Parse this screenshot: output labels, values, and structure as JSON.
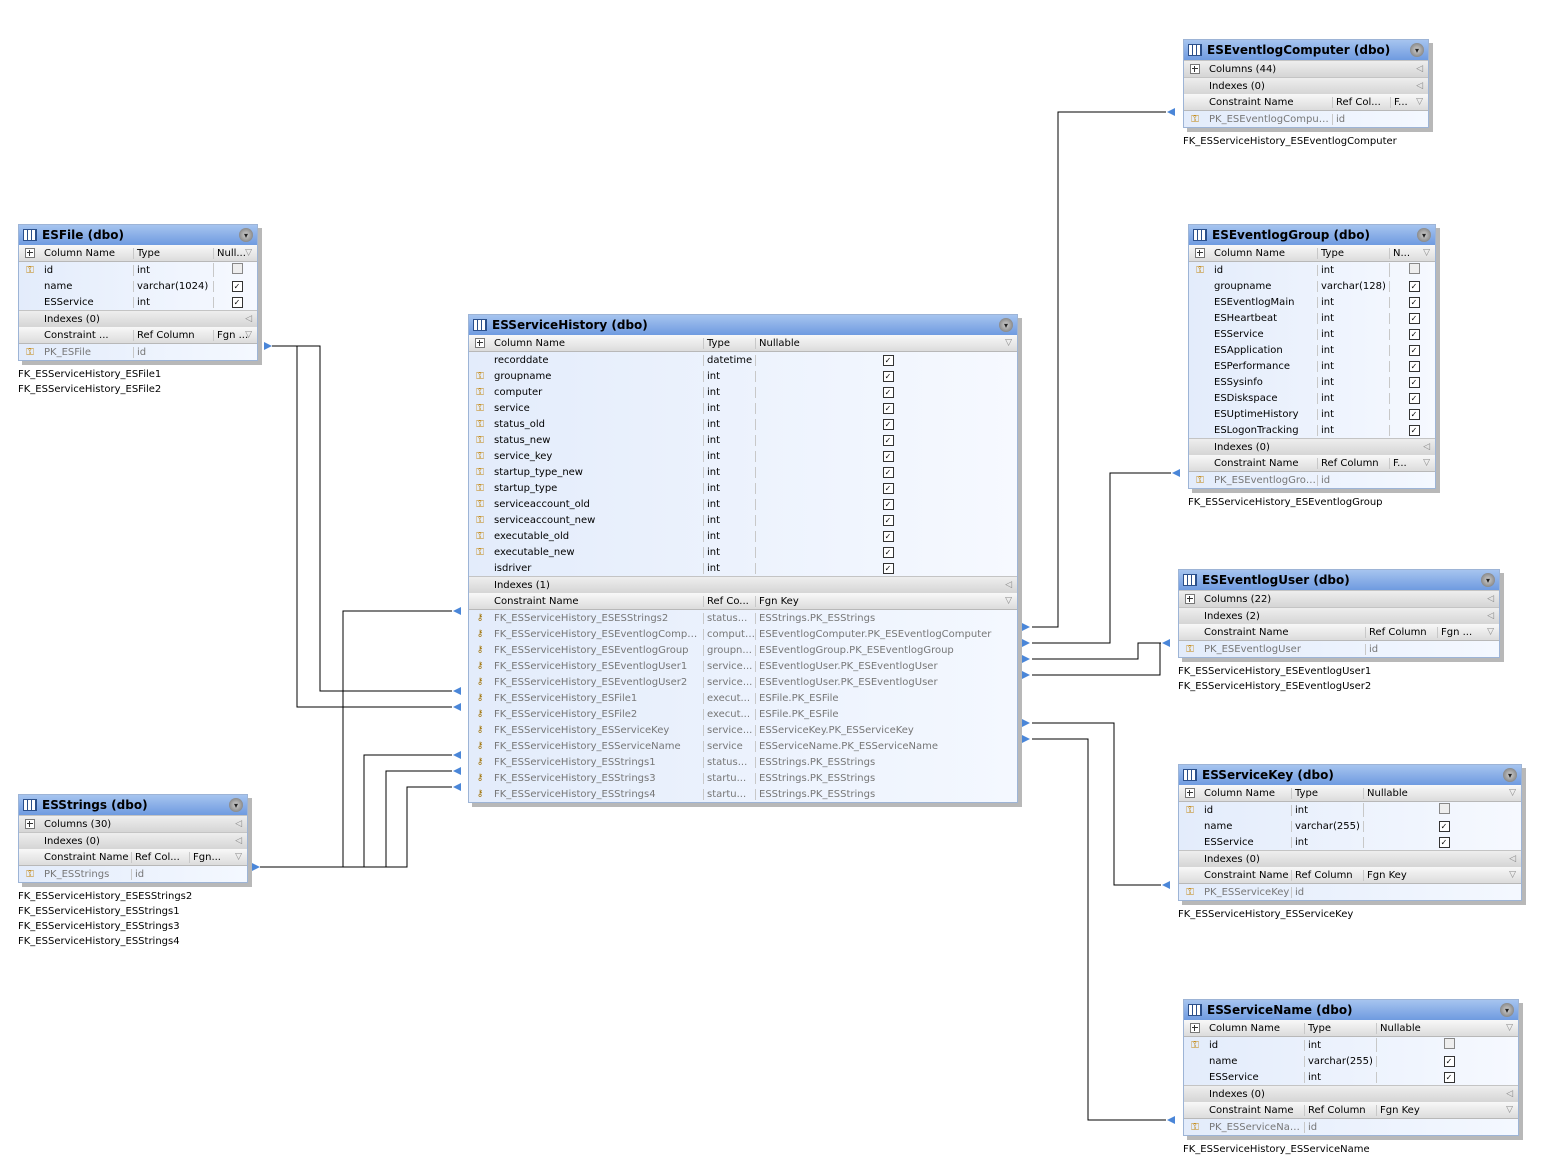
{
  "tables": [
    {
      "id": "ESFile",
      "title": "ESFile (dbo)",
      "expanded": true,
      "header": [
        "Column Name",
        "Type",
        "Null..."
      ],
      "columns": [
        {
          "name": "id",
          "type": "int",
          "nullable": false,
          "key": true
        },
        {
          "name": "name",
          "type": "varchar(1024)",
          "nullable": true,
          "key": false
        },
        {
          "name": "ESService",
          "type": "int",
          "nullable": true,
          "key": false
        }
      ],
      "indexes": "Indexes (0)",
      "constraint_header": [
        "Constraint ...",
        "Ref Column",
        "Fgn ..."
      ],
      "constraints": [
        {
          "name": "PK_ESFile",
          "ref": "id",
          "fgn": ""
        }
      ],
      "captions": [
        "FK_ESServiceHistory_ESFile1",
        "FK_ESServiceHistory_ESFile2"
      ]
    },
    {
      "id": "ESStrings",
      "title": "ESStrings (dbo)",
      "expanded": false,
      "columns_summary": "Columns (30)",
      "indexes": "Indexes (0)",
      "constraint_header": [
        "Constraint Name",
        "Ref Col...",
        "Fgn..."
      ],
      "constraints": [
        {
          "name": "PK_ESStrings",
          "ref": "id",
          "fgn": ""
        }
      ],
      "captions": [
        "FK_ESServiceHistory_ESESStrings2",
        "FK_ESServiceHistory_ESStrings1",
        "FK_ESServiceHistory_ESStrings3",
        "FK_ESServiceHistory_ESStrings4"
      ]
    },
    {
      "id": "ESServiceHistory",
      "title": "ESServiceHistory (dbo)",
      "expanded": true,
      "header": [
        "Column Name",
        "Type",
        "Nullable"
      ],
      "columns": [
        {
          "name": "recorddate",
          "type": "datetime",
          "nullable": true,
          "key": false
        },
        {
          "name": "groupname",
          "type": "int",
          "nullable": true,
          "key": true
        },
        {
          "name": "computer",
          "type": "int",
          "nullable": true,
          "key": true
        },
        {
          "name": "service",
          "type": "int",
          "nullable": true,
          "key": true
        },
        {
          "name": "status_old",
          "type": "int",
          "nullable": true,
          "key": true
        },
        {
          "name": "status_new",
          "type": "int",
          "nullable": true,
          "key": true
        },
        {
          "name": "service_key",
          "type": "int",
          "nullable": true,
          "key": true
        },
        {
          "name": "startup_type_new",
          "type": "int",
          "nullable": true,
          "key": true
        },
        {
          "name": "startup_type",
          "type": "int",
          "nullable": true,
          "key": true
        },
        {
          "name": "serviceaccount_old",
          "type": "int",
          "nullable": true,
          "key": true
        },
        {
          "name": "serviceaccount_new",
          "type": "int",
          "nullable": true,
          "key": true
        },
        {
          "name": "executable_old",
          "type": "int",
          "nullable": true,
          "key": true
        },
        {
          "name": "executable_new",
          "type": "int",
          "nullable": true,
          "key": true
        },
        {
          "name": "isdriver",
          "type": "int",
          "nullable": true,
          "key": false
        }
      ],
      "indexes": "Indexes (1)",
      "constraint_header": [
        "Constraint Name",
        "Ref Co...",
        "Fgn Key"
      ],
      "constraints": [
        {
          "name": "FK_ESServiceHistory_ESESStrings2",
          "ref": "status...",
          "fgn": "ESStrings.PK_ESStrings"
        },
        {
          "name": "FK_ESServiceHistory_ESEventlogComputer",
          "ref": "computer",
          "fgn": "ESEventlogComputer.PK_ESEventlogComputer"
        },
        {
          "name": "FK_ESServiceHistory_ESEventlogGroup",
          "ref": "groupn...",
          "fgn": "ESEventlogGroup.PK_ESEventlogGroup"
        },
        {
          "name": "FK_ESServiceHistory_ESEventlogUser1",
          "ref": "service...",
          "fgn": "ESEventlogUser.PK_ESEventlogUser"
        },
        {
          "name": "FK_ESServiceHistory_ESEventlogUser2",
          "ref": "service...",
          "fgn": "ESEventlogUser.PK_ESEventlogUser"
        },
        {
          "name": "FK_ESServiceHistory_ESFile1",
          "ref": "execut...",
          "fgn": "ESFile.PK_ESFile"
        },
        {
          "name": "FK_ESServiceHistory_ESFile2",
          "ref": "execut...",
          "fgn": "ESFile.PK_ESFile"
        },
        {
          "name": "FK_ESServiceHistory_ESServiceKey",
          "ref": "service...",
          "fgn": "ESServiceKey.PK_ESServiceKey"
        },
        {
          "name": "FK_ESServiceHistory_ESServiceName",
          "ref": "service",
          "fgn": "ESServiceName.PK_ESServiceName"
        },
        {
          "name": "FK_ESServiceHistory_ESStrings1",
          "ref": "status...",
          "fgn": "ESStrings.PK_ESStrings"
        },
        {
          "name": "FK_ESServiceHistory_ESStrings3",
          "ref": "startu...",
          "fgn": "ESStrings.PK_ESStrings"
        },
        {
          "name": "FK_ESServiceHistory_ESStrings4",
          "ref": "startu...",
          "fgn": "ESStrings.PK_ESStrings"
        }
      ],
      "captions": []
    },
    {
      "id": "ESEventlogComputer",
      "title": "ESEventlogComputer (dbo)",
      "expanded": false,
      "columns_summary": "Columns (44)",
      "indexes": "Indexes (0)",
      "constraint_header": [
        "Constraint Name",
        "Ref Col...",
        "F..."
      ],
      "constraints": [
        {
          "name": "PK_ESEventlogComputer",
          "ref": "id",
          "fgn": ""
        }
      ],
      "captions": [
        "FK_ESServiceHistory_ESEventlogComputer"
      ]
    },
    {
      "id": "ESEventlogGroup",
      "title": "ESEventlogGroup (dbo)",
      "expanded": true,
      "header": [
        "Column Name",
        "Type",
        "N..."
      ],
      "columns": [
        {
          "name": "id",
          "type": "int",
          "nullable": false,
          "key": true
        },
        {
          "name": "groupname",
          "type": "varchar(128)",
          "nullable": true,
          "key": false
        },
        {
          "name": "ESEventlogMain",
          "type": "int",
          "nullable": true,
          "key": false
        },
        {
          "name": "ESHeartbeat",
          "type": "int",
          "nullable": true,
          "key": false
        },
        {
          "name": "ESService",
          "type": "int",
          "nullable": true,
          "key": false
        },
        {
          "name": "ESApplication",
          "type": "int",
          "nullable": true,
          "key": false
        },
        {
          "name": "ESPerformance",
          "type": "int",
          "nullable": true,
          "key": false
        },
        {
          "name": "ESSysinfo",
          "type": "int",
          "nullable": true,
          "key": false
        },
        {
          "name": "ESDiskspace",
          "type": "int",
          "nullable": true,
          "key": false
        },
        {
          "name": "ESUptimeHistory",
          "type": "int",
          "nullable": true,
          "key": false
        },
        {
          "name": "ESLogonTracking",
          "type": "int",
          "nullable": true,
          "key": false
        }
      ],
      "indexes": "Indexes (0)",
      "constraint_header": [
        "Constraint Name",
        "Ref Column",
        "F..."
      ],
      "constraints": [
        {
          "name": "PK_ESEventlogGroup",
          "ref": "id",
          "fgn": ""
        }
      ],
      "captions": [
        "FK_ESServiceHistory_ESEventlogGroup"
      ]
    },
    {
      "id": "ESEventlogUser",
      "title": "ESEventlogUser (dbo)",
      "expanded": false,
      "columns_summary": "Columns (22)",
      "indexes": "Indexes (2)",
      "constraint_header": [
        "Constraint Name",
        "Ref Column",
        "Fgn ..."
      ],
      "constraints": [
        {
          "name": "PK_ESEventlogUser",
          "ref": "id",
          "fgn": ""
        }
      ],
      "captions": [
        "FK_ESServiceHistory_ESEventlogUser1",
        "FK_ESServiceHistory_ESEventlogUser2"
      ]
    },
    {
      "id": "ESServiceKey",
      "title": "ESServiceKey (dbo)",
      "expanded": true,
      "header": [
        "Column Name",
        "Type",
        "Nullable"
      ],
      "columns": [
        {
          "name": "id",
          "type": "int",
          "nullable": false,
          "key": true
        },
        {
          "name": "name",
          "type": "varchar(255)",
          "nullable": true,
          "key": false
        },
        {
          "name": "ESService",
          "type": "int",
          "nullable": true,
          "key": false
        }
      ],
      "indexes": "Indexes (0)",
      "constraint_header": [
        "Constraint Name",
        "Ref Column",
        "Fgn Key"
      ],
      "constraints": [
        {
          "name": "PK_ESServiceKey",
          "ref": "id",
          "fgn": ""
        }
      ],
      "captions": [
        "FK_ESServiceHistory_ESServiceKey"
      ]
    },
    {
      "id": "ESServiceName",
      "title": "ESServiceName (dbo)",
      "expanded": true,
      "header": [
        "Column Name",
        "Type",
        "Nullable"
      ],
      "columns": [
        {
          "name": "id",
          "type": "int",
          "nullable": false,
          "key": true
        },
        {
          "name": "name",
          "type": "varchar(255)",
          "nullable": true,
          "key": false
        },
        {
          "name": "ESService",
          "type": "int",
          "nullable": true,
          "key": false
        }
      ],
      "indexes": "Indexes (0)",
      "constraint_header": [
        "Constraint Name",
        "Ref Column",
        "Fgn Key"
      ],
      "constraints": [
        {
          "name": "PK_ESServiceName",
          "ref": "id",
          "fgn": ""
        }
      ],
      "captions": [
        "FK_ESServiceHistory_ESServiceName"
      ]
    }
  ],
  "icons": {
    "table": "table-icon",
    "expand": "plus-icon",
    "collapse": "collapse-arrow-icon",
    "primary_key": "primary-key-icon",
    "foreign_key": "foreign-key-icon",
    "checkbox": "checkbox-icon"
  },
  "colors": {
    "title_bar": "#7ea6e6",
    "panel": "#dfe8f7",
    "connector": "#000000",
    "arrow": "#4a86d8"
  }
}
